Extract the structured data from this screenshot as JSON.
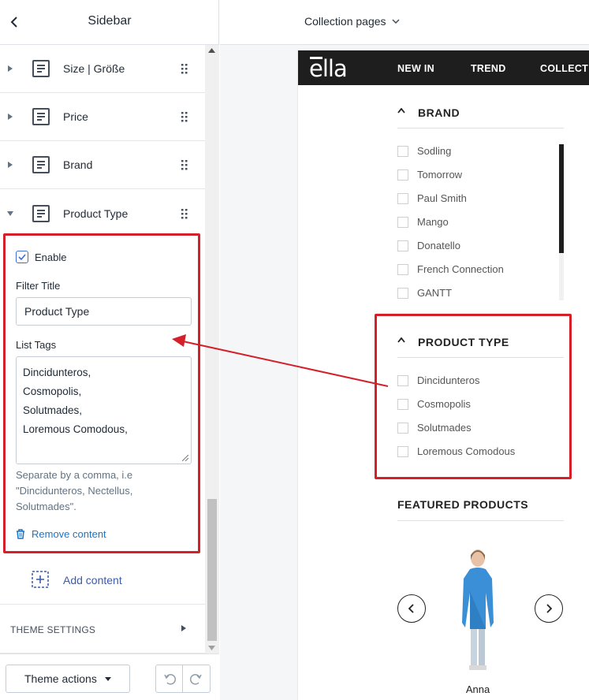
{
  "sidebar": {
    "title": "Sidebar",
    "blocks": [
      {
        "label": "Size | Größe",
        "expanded": false
      },
      {
        "label": "Price",
        "expanded": false
      },
      {
        "label": "Brand",
        "expanded": false
      },
      {
        "label": "Product Type",
        "expanded": true
      }
    ],
    "editor": {
      "enable_label": "Enable",
      "enabled": true,
      "filter_title_label": "Filter Title",
      "filter_title_value": "Product Type",
      "list_tags_label": "List Tags",
      "list_tags_lines": [
        "Dincidunteros,",
        "Cosmopolis,",
        "Solutmades,",
        "Loremous Comodous,"
      ],
      "help_text": "Separate by a comma, i.e \"Dincidunteros, Nectellus, Solutmades\".",
      "remove_label": "Remove content"
    },
    "add_content_label": "Add content",
    "theme_settings_label": "THEME SETTINGS",
    "footer": {
      "theme_actions_label": "Theme actions"
    }
  },
  "preview": {
    "page_selector": "Collection pages",
    "site": {
      "logo": "ella",
      "nav": [
        "NEW IN",
        "TREND",
        "COLLECT"
      ],
      "brand": {
        "title": "BRAND",
        "options": [
          "Sodling",
          "Tomorrow",
          "Paul Smith",
          "Mango",
          "Donatello",
          "French Connection",
          "GANTT"
        ]
      },
      "product_type": {
        "title": "PRODUCT TYPE",
        "options": [
          "Dincidunteros",
          "Cosmopolis",
          "Solutmades",
          "Loremous Comodous"
        ]
      },
      "featured": {
        "title": "FEATURED PRODUCTS",
        "product_name": "Anna"
      }
    }
  },
  "colors": {
    "highlight_red": "#d4202a",
    "link_blue": "#1d74c4",
    "nav_dark": "#1e1e1e",
    "product_blue": "#3a8fd6"
  },
  "icons": {
    "back": "chevron-left-icon",
    "block": "text-block-icon",
    "drag": "drag-handle-icon",
    "remove": "trash-icon",
    "add": "add-section-icon",
    "undo": "undo-icon",
    "redo": "redo-icon"
  }
}
